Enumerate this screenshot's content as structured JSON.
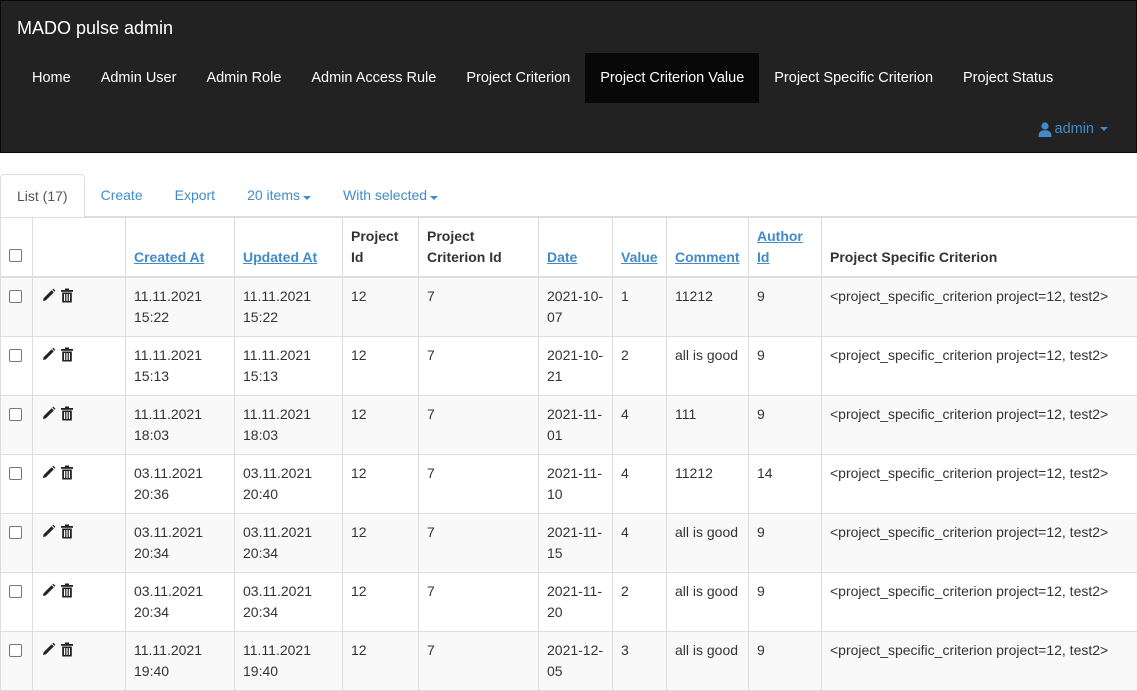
{
  "app": {
    "title": "MADO pulse admin"
  },
  "nav": {
    "items": [
      {
        "label": "Home"
      },
      {
        "label": "Admin User"
      },
      {
        "label": "Admin Role"
      },
      {
        "label": "Admin Access Rule"
      },
      {
        "label": "Project Criterion"
      },
      {
        "label": "Project Criterion Value",
        "active": true
      },
      {
        "label": "Project Specific Criterion"
      },
      {
        "label": "Project Status"
      }
    ],
    "user": "admin"
  },
  "tabs": {
    "list": "List (17)",
    "create": "Create",
    "export": "Export",
    "page_size": "20 items",
    "with_selected": "With selected"
  },
  "table": {
    "headers": {
      "created_at": "Created At",
      "updated_at": "Updated At",
      "project_id_1": "Project",
      "project_id_2": "Id",
      "criterion_id_1": "Project",
      "criterion_id_2": "Criterion Id",
      "date": "Date",
      "value": "Value",
      "comment": "Comment",
      "author_id_1": "Author",
      "author_id_2": "Id",
      "specific": "Project Specific Criterion"
    },
    "rows": [
      {
        "created_date": "11.11.2021",
        "created_time": "15:22",
        "updated_date": "11.11.2021",
        "updated_time": "15:22",
        "project_id": "12",
        "criterion_id": "7",
        "date_1": "2021-10-",
        "date_2": "07",
        "value": "1",
        "comment": "11212",
        "author_id": "9",
        "specific": "<project_specific_criterion project=12, test2>"
      },
      {
        "created_date": "11.11.2021",
        "created_time": "15:13",
        "updated_date": "11.11.2021",
        "updated_time": "15:13",
        "project_id": "12",
        "criterion_id": "7",
        "date_1": "2021-10-",
        "date_2": "21",
        "value": "2",
        "comment": "all is good",
        "author_id": "9",
        "specific": "<project_specific_criterion project=12, test2>"
      },
      {
        "created_date": "11.11.2021",
        "created_time": "18:03",
        "updated_date": "11.11.2021",
        "updated_time": "18:03",
        "project_id": "12",
        "criterion_id": "7",
        "date_1": "2021-11-",
        "date_2": "01",
        "value": "4",
        "comment": "111",
        "author_id": "9",
        "specific": "<project_specific_criterion project=12, test2>"
      },
      {
        "created_date": "03.11.2021",
        "created_time": "20:36",
        "updated_date": "03.11.2021",
        "updated_time": "20:40",
        "project_id": "12",
        "criterion_id": "7",
        "date_1": "2021-11-",
        "date_2": "10",
        "value": "4",
        "comment": "11212",
        "author_id": "14",
        "specific": "<project_specific_criterion project=12, test2>"
      },
      {
        "created_date": "03.11.2021",
        "created_time": "20:34",
        "updated_date": "03.11.2021",
        "updated_time": "20:34",
        "project_id": "12",
        "criterion_id": "7",
        "date_1": "2021-11-",
        "date_2": "15",
        "value": "4",
        "comment": "all is good",
        "author_id": "9",
        "specific": "<project_specific_criterion project=12, test2>"
      },
      {
        "created_date": "03.11.2021",
        "created_time": "20:34",
        "updated_date": "03.11.2021",
        "updated_time": "20:34",
        "project_id": "12",
        "criterion_id": "7",
        "date_1": "2021-11-",
        "date_2": "20",
        "value": "2",
        "comment": "all is good",
        "author_id": "9",
        "specific": "<project_specific_criterion project=12, test2>"
      },
      {
        "created_date": "11.11.2021",
        "created_time": "19:40",
        "updated_date": "11.11.2021",
        "updated_time": "19:40",
        "project_id": "12",
        "criterion_id": "7",
        "date_1": "2021-12-",
        "date_2": "05",
        "value": "3",
        "comment": "all is good",
        "author_id": "9",
        "specific": "<project_specific_criterion project=12, test2>"
      }
    ]
  },
  "colors": {
    "navbar": "#222222",
    "active_nav": "#080808",
    "link": "#428bca",
    "stripe": "#f9f9f9"
  }
}
